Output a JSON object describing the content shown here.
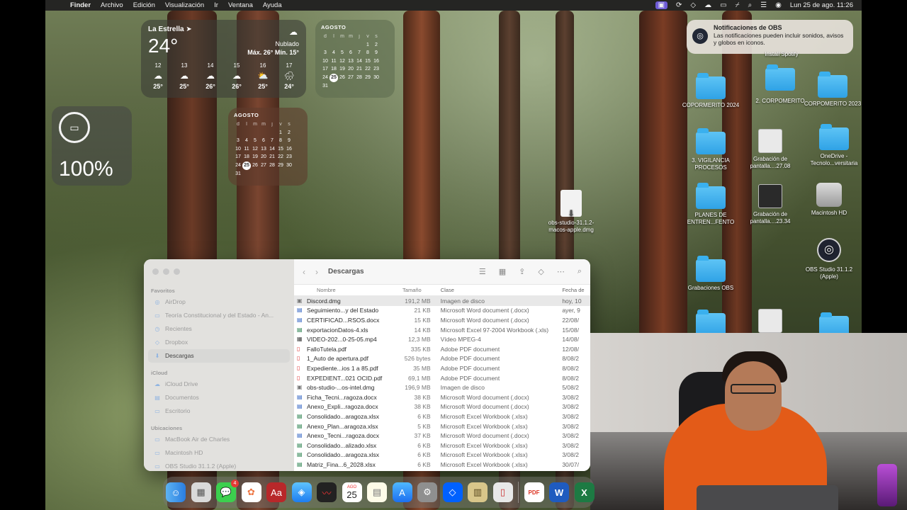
{
  "menubar": {
    "app": "Finder",
    "items": [
      "Archivo",
      "Edición",
      "Visualización",
      "Ir",
      "Ventana",
      "Ayuda"
    ],
    "datetime": "Lun 25 de ago.  11:26"
  },
  "weather": {
    "location": "La Estrella",
    "temp": "24°",
    "condition": "Nublado",
    "range": "Máx. 26° Mín. 15°",
    "hours": [
      {
        "h": "12",
        "icon": "☁",
        "t": "25°"
      },
      {
        "h": "13",
        "icon": "☁",
        "t": "25°"
      },
      {
        "h": "14",
        "icon": "☁",
        "t": "26°"
      },
      {
        "h": "15",
        "icon": "☁",
        "t": "26°"
      },
      {
        "h": "16",
        "icon": "⛅",
        "t": "25°"
      },
      {
        "h": "17",
        "icon": "🌧",
        "t": "24°"
      }
    ]
  },
  "calendar": {
    "month": "AGOSTO",
    "dow": [
      "d",
      "l",
      "m",
      "m",
      "j",
      "v",
      "s"
    ],
    "days": [
      "",
      "",
      "",
      "",
      "",
      "1",
      "2",
      "3",
      "4",
      "5",
      "6",
      "7",
      "8",
      "9",
      "10",
      "11",
      "12",
      "13",
      "14",
      "15",
      "16",
      "17",
      "18",
      "19",
      "20",
      "21",
      "22",
      "23",
      "24",
      "25",
      "26",
      "27",
      "28",
      "29",
      "30",
      "31"
    ],
    "today": "25"
  },
  "battery": {
    "percent": "100%"
  },
  "notification": {
    "title": "Notificaciones de OBS",
    "body": "Las notificaciones pueden incluir sonidos, avisos y globos en iconos."
  },
  "desktop_icons": {
    "install_spotify": "Install Spotify",
    "copormerito": "COPORMERITO 2024",
    "corpomerito2": "2. CORPOMERITO",
    "corpomerito2023": "CORPOMERITO 2023",
    "vigilancia": "3. VIGILANCIA PROCESOS",
    "grabacion1": "Grabación de pantalla....27.08",
    "onedrive": "OneDrive - Tecnolo...versitaria",
    "planes": "PLANES DE ENTREN...FENTO",
    "grabacion2": "Grabación de pantalla....23.34",
    "macintosh": "Macintosh HD",
    "grabaciones_obs": "Grabaciones OBS",
    "obs_studio": "OBS Studio 31.1.2 (Apple)",
    "obs_dmg": "obs-studio-31.1.2-macos-apple.dmg"
  },
  "finder": {
    "title": "Descargas",
    "sidebar": {
      "favoritos_label": "Favoritos",
      "favoritos": [
        "AirDrop",
        "Teoría Constitucional y del Estado - An...",
        "Recientes",
        "Dropbox",
        "Descargas"
      ],
      "icloud_label": "iCloud",
      "icloud": [
        "iCloud Drive",
        "Documentos",
        "Escritorio"
      ],
      "ubicaciones_label": "Ubicaciones",
      "ubicaciones": [
        "MacBook Air de Charles",
        "Macintosh HD",
        "OBS Studio 31.1.2 (Apple)"
      ]
    },
    "columns": {
      "name": "Nombre",
      "size": "Tamaño",
      "kind": "Clase",
      "date": "Fecha de"
    },
    "files": [
      {
        "name": "Discord.dmg",
        "size": "191,2 MB",
        "kind": "Imagen de disco",
        "date": "hoy, 10",
        "icon": "dmg"
      },
      {
        "name": "Seguimiento...y del Estado",
        "size": "21 KB",
        "kind": "Microsoft Word document (.docx)",
        "date": "ayer, 9",
        "icon": "word"
      },
      {
        "name": "CERTIFICAD...RSOS.docx",
        "size": "15 KB",
        "kind": "Microsoft Word document (.docx)",
        "date": "22/08/",
        "icon": "word"
      },
      {
        "name": "exportacionDatos-4.xls",
        "size": "14 KB",
        "kind": "Microsoft Excel 97-2004 Workbook (.xls)",
        "date": "15/08/",
        "icon": "excel"
      },
      {
        "name": "VIDEO-202...0-25-05.mp4",
        "size": "12,3 MB",
        "kind": "Vídeo MPEG-4",
        "date": "14/08/",
        "icon": "video"
      },
      {
        "name": "FalloTutela.pdf",
        "size": "335 KB",
        "kind": "Adobe PDF document",
        "date": "12/08/",
        "icon": "pdf"
      },
      {
        "name": "1_Auto de apertura.pdf",
        "size": "526 bytes",
        "kind": "Adobe PDF document",
        "date": "8/08/2",
        "icon": "pdf"
      },
      {
        "name": "Expediente...ios 1 a 85.pdf",
        "size": "35 MB",
        "kind": "Adobe PDF document",
        "date": "8/08/2",
        "icon": "pdf"
      },
      {
        "name": "EXPEDIENT...021 OCID.pdf",
        "size": "69,1 MB",
        "kind": "Adobe PDF document",
        "date": "8/08/2",
        "icon": "pdf"
      },
      {
        "name": "obs-studio-...os-intel.dmg",
        "size": "196,9 MB",
        "kind": "Imagen de disco",
        "date": "5/08/2",
        "icon": "dmg"
      },
      {
        "name": "Ficha_Tecni...ragoza.docx",
        "size": "38 KB",
        "kind": "Microsoft Word document (.docx)",
        "date": "3/08/2",
        "icon": "word"
      },
      {
        "name": "Anexo_Expli...ragoza.docx",
        "size": "38 KB",
        "kind": "Microsoft Word document (.docx)",
        "date": "3/08/2",
        "icon": "word"
      },
      {
        "name": "Consolidado...aragoza.xlsx",
        "size": "6 KB",
        "kind": "Microsoft Excel Workbook (.xlsx)",
        "date": "3/08/2",
        "icon": "excel"
      },
      {
        "name": "Anexo_Plan...aragoza.xlsx",
        "size": "5 KB",
        "kind": "Microsoft Excel Workbook (.xlsx)",
        "date": "3/08/2",
        "icon": "excel"
      },
      {
        "name": "Anexo_Tecni...ragoza.docx",
        "size": "37 KB",
        "kind": "Microsoft Word document (.docx)",
        "date": "3/08/2",
        "icon": "word"
      },
      {
        "name": "Consolidado...alizado.xlsx",
        "size": "6 KB",
        "kind": "Microsoft Excel Workbook (.xlsx)",
        "date": "3/08/2",
        "icon": "excel"
      },
      {
        "name": "Consolidado...aragoza.xlsx",
        "size": "6 KB",
        "kind": "Microsoft Excel Workbook (.xlsx)",
        "date": "3/08/2",
        "icon": "excel"
      },
      {
        "name": "Matriz_Fina...6_2028.xlsx",
        "size": "6 KB",
        "kind": "Microsoft Excel Workbook (.xlsx)",
        "date": "30/07/",
        "icon": "excel"
      }
    ]
  },
  "dock": {
    "calendar_month": "AGO",
    "calendar_day": "25",
    "messages_badge": "4",
    "dictionary_label": "Aa",
    "pdf_label": "PDF",
    "word_label": "W",
    "excel_label": "X"
  }
}
